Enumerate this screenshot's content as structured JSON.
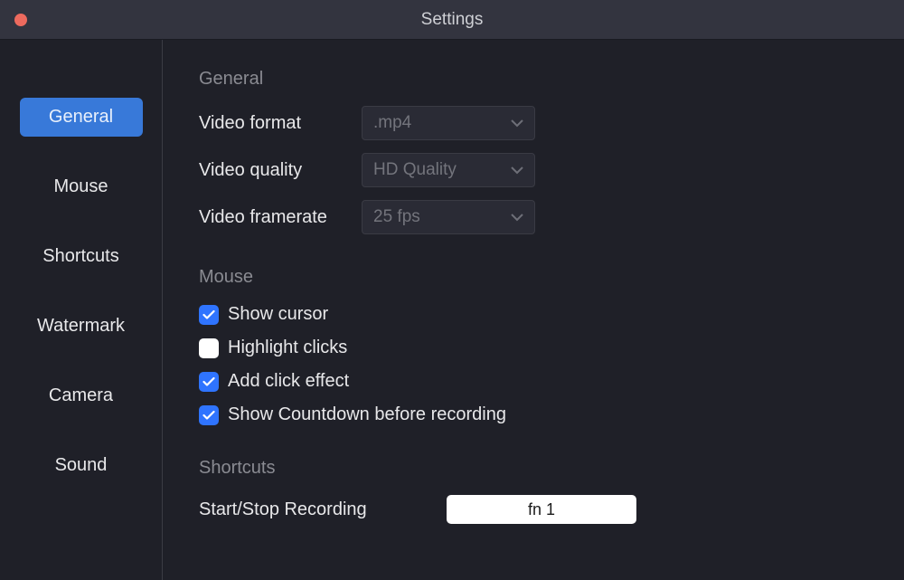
{
  "window": {
    "title": "Settings"
  },
  "sidebar": {
    "items": [
      {
        "label": "General",
        "active": true
      },
      {
        "label": "Mouse",
        "active": false
      },
      {
        "label": "Shortcuts",
        "active": false
      },
      {
        "label": "Watermark",
        "active": false
      },
      {
        "label": "Camera",
        "active": false
      },
      {
        "label": "Sound",
        "active": false
      }
    ]
  },
  "sections": {
    "general": {
      "heading": "General",
      "video_format": {
        "label": "Video format",
        "value": ".mp4"
      },
      "video_quality": {
        "label": "Video quality",
        "value": "HD Quality"
      },
      "video_framerate": {
        "label": "Video framerate",
        "value": "25 fps"
      }
    },
    "mouse": {
      "heading": "Mouse",
      "show_cursor": {
        "label": "Show cursor",
        "checked": true
      },
      "highlight_clicks": {
        "label": "Highlight clicks",
        "checked": false
      },
      "add_click_effect": {
        "label": "Add click effect",
        "checked": true
      },
      "show_countdown": {
        "label": "Show Countdown before recording",
        "checked": true
      }
    },
    "shortcuts": {
      "heading": "Shortcuts",
      "start_stop": {
        "label": "Start/Stop Recording",
        "value": "fn 1"
      }
    }
  }
}
